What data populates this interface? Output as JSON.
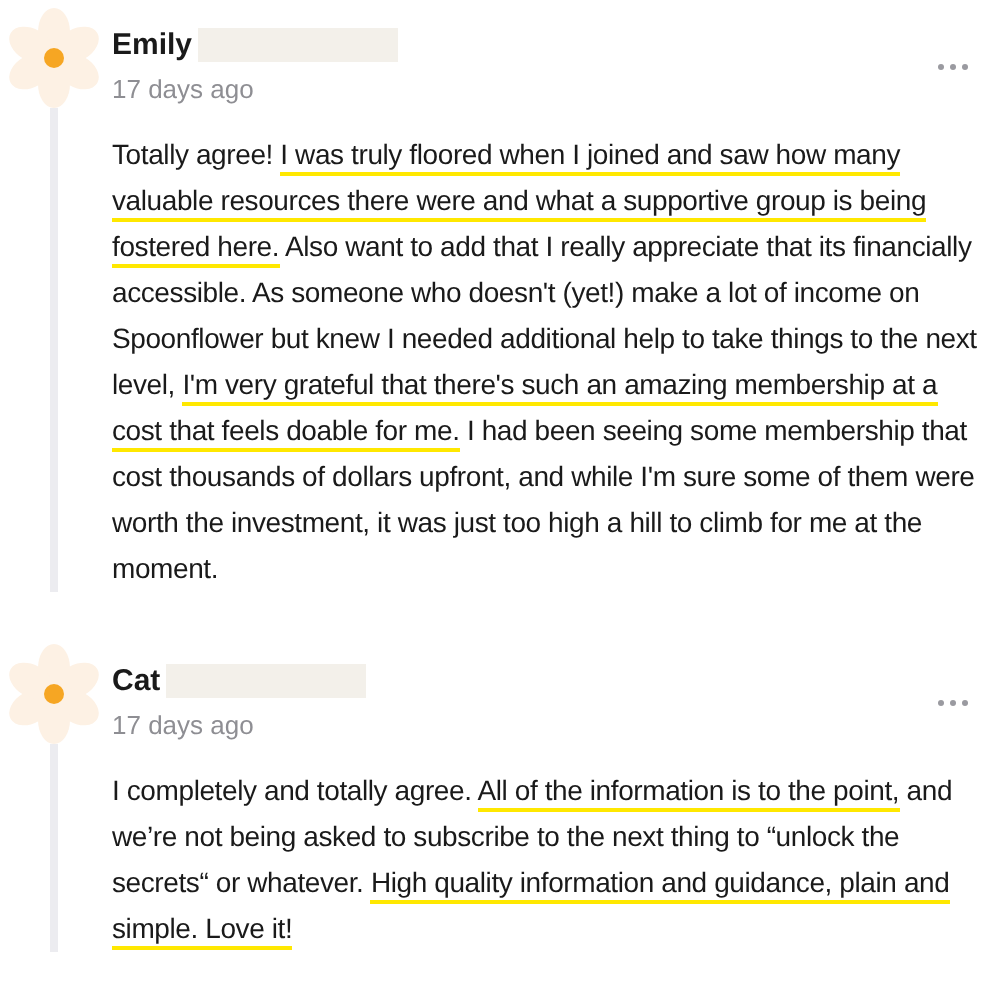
{
  "comments": [
    {
      "author": "Emily",
      "redacted": true,
      "time": "17 days ago",
      "body": [
        {
          "text": "Totally agree! ",
          "highlighted": false
        },
        {
          "text": "I was truly floored when I joined and saw how many valuable resources there were and what a supportive group is being fostered here.",
          "highlighted": true
        },
        {
          "text": " Also want to add that I really appreciate that its financially accessible. As someone who doesn't (yet!) make a lot of income on Spoonflower but knew I needed additional help to take things to the next level, ",
          "highlighted": false
        },
        {
          "text": "I'm very grateful that there's such an amazing membership at a cost that feels doable for me.",
          "highlighted": true
        },
        {
          "text": " I had been seeing some membership that cost thousands of dollars upfront, and while I'm sure some of them were worth the investment, it was just too high a hill to climb for me at the moment.",
          "highlighted": false
        }
      ]
    },
    {
      "author": "Cat",
      "redacted": true,
      "time": "17 days ago",
      "body": [
        {
          "text": "I completely and totally agree. ",
          "highlighted": false
        },
        {
          "text": "All of the information is to the point,",
          "highlighted": true
        },
        {
          "text": " and we’re not being asked to subscribe to the next thing to “unlock the secrets“ or whatever. ",
          "highlighted": false
        },
        {
          "text": "High quality information and guidance, plain and simple. Love it!",
          "highlighted": true
        }
      ]
    }
  ]
}
